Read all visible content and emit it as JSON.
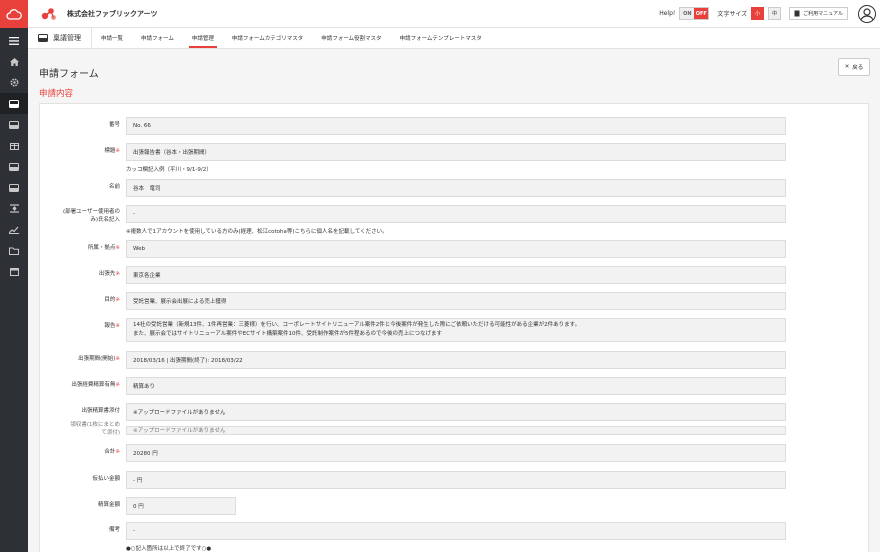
{
  "company": "株式会社ファブリックアーツ",
  "topbar": {
    "help": "Help!",
    "toggle_on": "ON",
    "toggle_off": "OFF",
    "font_size_label": "文字サイズ",
    "font_small": "小",
    "font_mid": "中",
    "manual": "ご利用マニュアル"
  },
  "subnav": {
    "home": "稟議管理",
    "tabs": [
      "申請一覧",
      "申請フォーム",
      "申請管理",
      "申請フォームカテゴリマスタ",
      "申請フォーム役割マスタ",
      "申請フォームテンプレートマスタ"
    ]
  },
  "page_title": "申請フォーム",
  "back_label": "戻る",
  "section_title": "申請内容",
  "form": {
    "number": {
      "label": "番号",
      "value": "No. 66"
    },
    "title": {
      "label": "標題",
      "value": "出張報告書（谷本・出張期間）",
      "note": "カッコ欄記入例（平川・9/1-9/2）"
    },
    "name": {
      "label": "名前",
      "value": "谷本　竜司"
    },
    "shared_user": {
      "label1": "(部署ユーザー使用者の",
      "label2": "み)氏名記入",
      "value": "-",
      "note": "※複数人で1アカウントを使用している方のみ(経理、松江cotoha等)こちらに個人名を記載してください。"
    },
    "affiliation": {
      "label": "所属・拠点",
      "value": "Web"
    },
    "destination": {
      "label": "出張先",
      "value": "東京各企業"
    },
    "purpose": {
      "label": "目的",
      "value": "受託営業、展示会出展による売上獲得"
    },
    "report": {
      "label": "報告",
      "line1": "14社の受託営業（新規13件、1件再営業：三菱様）を行い、コーポレートサイトリニューアル案件2件と今後案件が発生した際にご依頼いただける可能性がある企業が2件あります。",
      "line2": "また、展示会ではサイトリニューアル案件やECサイト構築案件10件、受託制作案件が5件程あるので今後の売上につなげます"
    },
    "period": {
      "label": "出張期間(開始)",
      "value": "2018/03/16 | 出張期間(終了): 2018/03/22"
    },
    "expense_flag": {
      "label": "出張経費精算有無",
      "value": "精算あり"
    },
    "expense_attach": {
      "label": "出張精算書添付",
      "value": "※アップロードファイルがありません"
    },
    "receipt": {
      "label1": "領収書(1枚にまとめ",
      "label2": "て添付)",
      "value": "※アップロードファイルがありません"
    },
    "total": {
      "label": "合計",
      "value": "20280 円"
    },
    "advance": {
      "label": "仮払い金額",
      "value": "- 円"
    },
    "settlement": {
      "label": "精算金額",
      "value": "0 円"
    },
    "remarks": {
      "label": "備考",
      "value": "-"
    },
    "end_note": "●○記入箇所は以上で終了です○●"
  }
}
